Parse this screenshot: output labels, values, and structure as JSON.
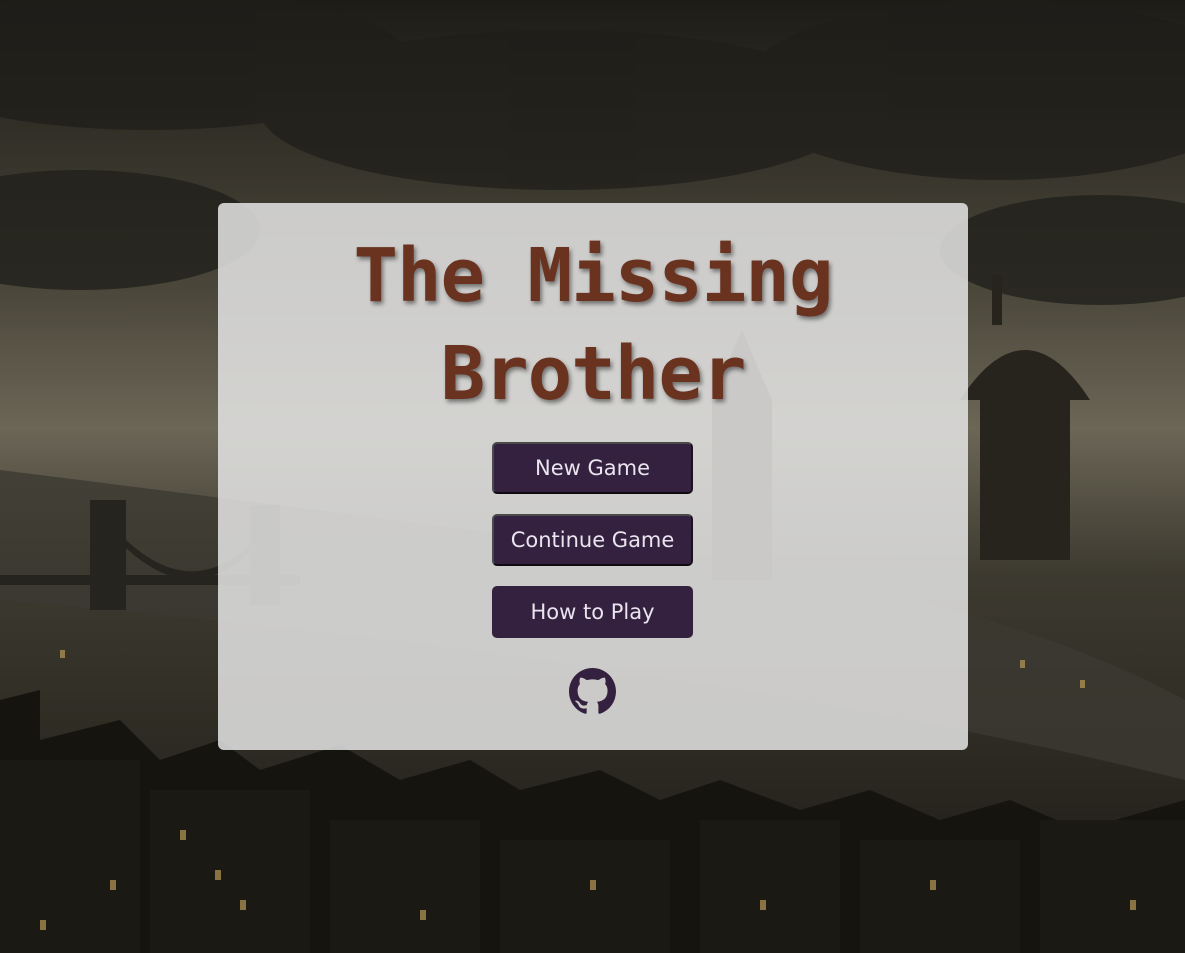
{
  "title": {
    "line1": "The Missing",
    "line2": "Brother"
  },
  "menu": {
    "new_game": "New Game",
    "continue_game": "Continue Game",
    "how_to_play": "How to Play"
  },
  "footer": {
    "icon": "github-icon"
  },
  "colors": {
    "title": "#6a3320",
    "button_bg": "#34213f",
    "button_text": "#e9e4ee",
    "card_bg": "#e4e4e4",
    "icon": "#34213f"
  }
}
